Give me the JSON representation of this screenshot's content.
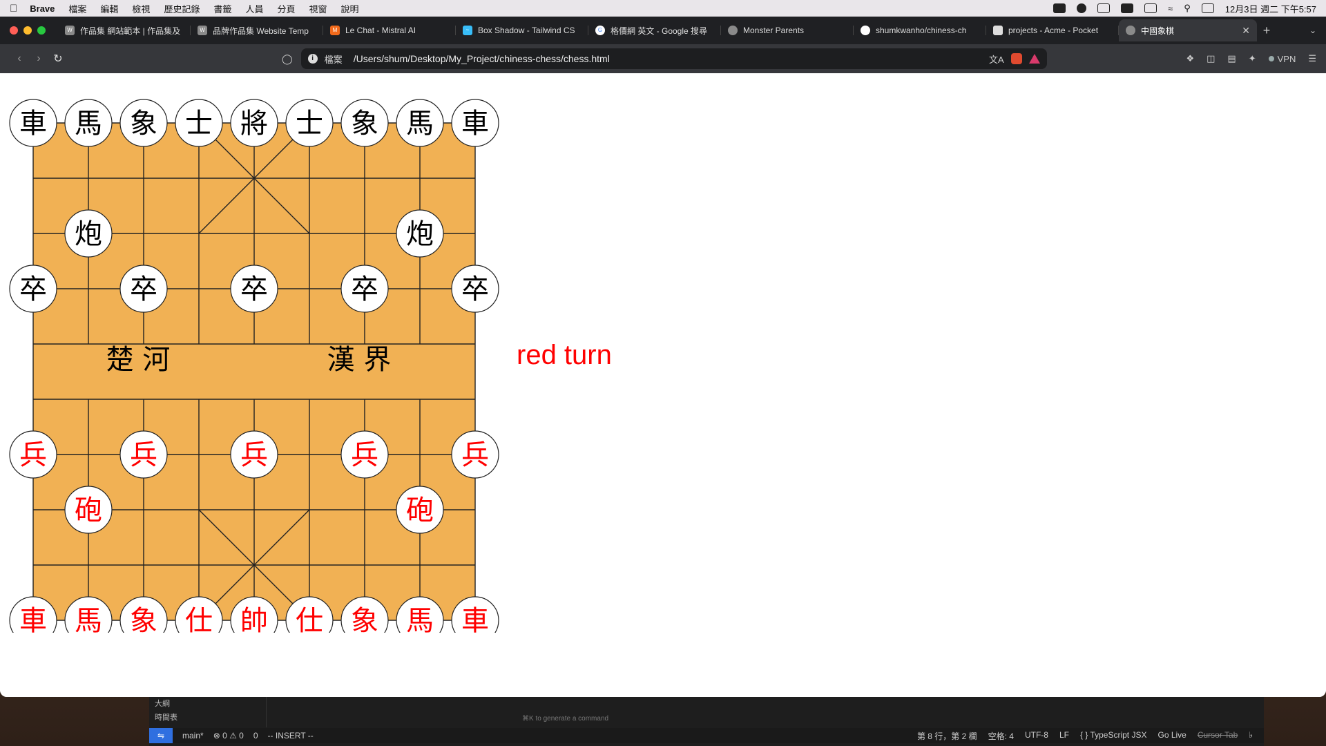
{
  "menubar": {
    "app_name": "Brave",
    "items": [
      "檔案",
      "編輯",
      "檢視",
      "歷史記錄",
      "書籤",
      "人員",
      "分頁",
      "視窗",
      "說明"
    ],
    "clock": "12月3日 週二 下午5:57"
  },
  "tabs": [
    {
      "title": "作品集 網站範本 | 作品集及",
      "icon": "wix-icon"
    },
    {
      "title": "品牌作品集 Website Temp",
      "icon": "wix-icon"
    },
    {
      "title": "Le Chat - Mistral AI",
      "icon": "mistral-icon"
    },
    {
      "title": "Box Shadow - Tailwind CS",
      "icon": "tailwind-icon"
    },
    {
      "title": "格價網 英文 - Google 搜尋",
      "icon": "google-icon"
    },
    {
      "title": "Monster Parents",
      "icon": "globe-icon"
    },
    {
      "title": "shumkwanho/chiness-ch",
      "icon": "github-icon"
    },
    {
      "title": "projects - Acme - Pocket",
      "icon": "pocketbase-icon"
    },
    {
      "title": "中國象棋",
      "icon": "globe-icon",
      "active": true
    }
  ],
  "address": {
    "scheme_label": "檔案",
    "url": "/Users/shum/Desktop/My_Project/chiness-chess/chess.html"
  },
  "toolbar": {
    "vpn_label": "VPN"
  },
  "game": {
    "turn_text": "red turn",
    "river_left": "楚 河",
    "river_right": "漢 界",
    "colors": {
      "board": "#f1b154",
      "red": "#ff0000",
      "black": "#000000",
      "piece_bg": "#ffffff"
    },
    "pieces": [
      {
        "char": "車",
        "side": "black",
        "col": 0,
        "row": 0
      },
      {
        "char": "馬",
        "side": "black",
        "col": 1,
        "row": 0
      },
      {
        "char": "象",
        "side": "black",
        "col": 2,
        "row": 0
      },
      {
        "char": "士",
        "side": "black",
        "col": 3,
        "row": 0
      },
      {
        "char": "將",
        "side": "black",
        "col": 4,
        "row": 0
      },
      {
        "char": "士",
        "side": "black",
        "col": 5,
        "row": 0
      },
      {
        "char": "象",
        "side": "black",
        "col": 6,
        "row": 0
      },
      {
        "char": "馬",
        "side": "black",
        "col": 7,
        "row": 0
      },
      {
        "char": "車",
        "side": "black",
        "col": 8,
        "row": 0
      },
      {
        "char": "炮",
        "side": "black",
        "col": 1,
        "row": 2
      },
      {
        "char": "炮",
        "side": "black",
        "col": 7,
        "row": 2
      },
      {
        "char": "卒",
        "side": "black",
        "col": 0,
        "row": 3
      },
      {
        "char": "卒",
        "side": "black",
        "col": 2,
        "row": 3
      },
      {
        "char": "卒",
        "side": "black",
        "col": 4,
        "row": 3
      },
      {
        "char": "卒",
        "side": "black",
        "col": 6,
        "row": 3
      },
      {
        "char": "卒",
        "side": "black",
        "col": 8,
        "row": 3
      },
      {
        "char": "兵",
        "side": "red",
        "col": 0,
        "row": 6
      },
      {
        "char": "兵",
        "side": "red",
        "col": 2,
        "row": 6
      },
      {
        "char": "兵",
        "side": "red",
        "col": 4,
        "row": 6
      },
      {
        "char": "兵",
        "side": "red",
        "col": 6,
        "row": 6
      },
      {
        "char": "兵",
        "side": "red",
        "col": 8,
        "row": 6
      },
      {
        "char": "砲",
        "side": "red",
        "col": 1,
        "row": 7
      },
      {
        "char": "砲",
        "side": "red",
        "col": 7,
        "row": 7
      },
      {
        "char": "車",
        "side": "red",
        "col": 0,
        "row": 9
      },
      {
        "char": "馬",
        "side": "red",
        "col": 1,
        "row": 9
      },
      {
        "char": "象",
        "side": "red",
        "col": 2,
        "row": 9
      },
      {
        "char": "仕",
        "side": "red",
        "col": 3,
        "row": 9
      },
      {
        "char": "帥",
        "side": "red",
        "col": 4,
        "row": 9
      },
      {
        "char": "仕",
        "side": "red",
        "col": 5,
        "row": 9
      },
      {
        "char": "象",
        "side": "red",
        "col": 6,
        "row": 9
      },
      {
        "char": "馬",
        "side": "red",
        "col": 7,
        "row": 9
      },
      {
        "char": "車",
        "side": "red",
        "col": 8,
        "row": 9
      }
    ]
  },
  "editor": {
    "sidebar": [
      "大綱",
      "時間表"
    ],
    "hint": "⌘K to generate a command",
    "status": {
      "branch": "main*",
      "problems": "⊗ 0 ⚠ 0",
      "ports": "0",
      "mode": "-- INSERT --",
      "position": "第 8 行，第 2 欄",
      "spaces": "空格: 4",
      "encoding": "UTF-8",
      "eol": "LF",
      "language": "{ } TypeScript JSX",
      "golive": "Go Live",
      "cursor_tab": "Cursor Tab"
    }
  }
}
